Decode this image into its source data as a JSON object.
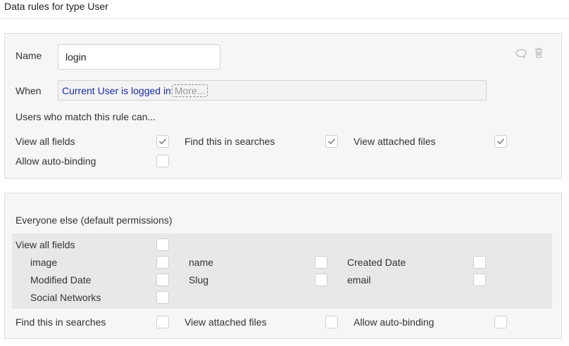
{
  "page": {
    "title": "Data rules for type User"
  },
  "rule": {
    "name_label": "Name",
    "name_value": "login",
    "when_label": "When",
    "when_expression": "Current User is logged in",
    "more_label": "More...",
    "match_heading": "Users who match this rule can...",
    "permissions": {
      "view_all_fields": {
        "label": "View all fields",
        "checked": true
      },
      "find_in_searches": {
        "label": "Find this in searches",
        "checked": true
      },
      "view_attached_files": {
        "label": "View attached files",
        "checked": true
      },
      "allow_auto_binding": {
        "label": "Allow auto-binding",
        "checked": false
      }
    },
    "comment_icon": "speech-bubble-icon",
    "delete_icon": "trash-icon"
  },
  "default": {
    "heading": "Everyone else (default permissions)",
    "view_all_fields": {
      "label": "View all fields",
      "checked": false
    },
    "fields": {
      "image": "image",
      "name": "name",
      "created_date": "Created Date",
      "modified_date": "Modified Date",
      "slug": "Slug",
      "email": "email",
      "social_networks": "Social Networks"
    },
    "find_in_searches": {
      "label": "Find this in searches",
      "checked": false
    },
    "view_attached_files": {
      "label": "View attached files",
      "checked": false
    },
    "allow_auto_binding": {
      "label": "Allow auto-binding",
      "checked": false
    }
  },
  "colors": {
    "expression_blue": "#1b2ba8",
    "panel_bg": "#f6f6f6",
    "band_bg": "#e8e8e8",
    "check_gray": "#8a8a8a"
  }
}
